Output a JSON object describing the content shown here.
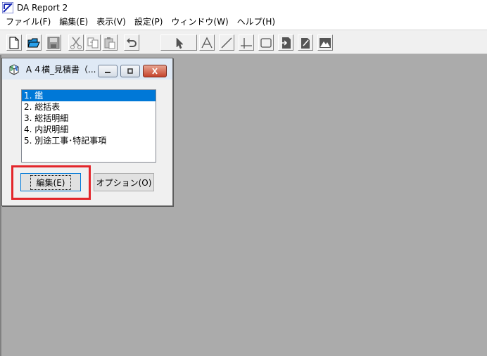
{
  "window": {
    "title": "DA Report 2"
  },
  "menu": [
    "ファイル(F)",
    "編集(E)",
    "表示(V)",
    "設定(P)",
    "ウィンドウ(W)",
    "ヘルプ(H)"
  ],
  "toolbar": {
    "buttons": [
      {
        "name": "new-file-icon"
      },
      {
        "name": "open-folder-icon"
      },
      {
        "name": "save-disk-icon"
      },
      {
        "name": "cut-scissors-icon"
      },
      {
        "name": "copy-icon"
      },
      {
        "name": "paste-icon"
      },
      {
        "name": "undo-icon"
      },
      {
        "name": "select-arrow-icon"
      },
      {
        "name": "text-tool-icon"
      },
      {
        "name": "line-tool-icon"
      },
      {
        "name": "perpendicular-line-icon"
      },
      {
        "name": "rectangle-tool-icon"
      },
      {
        "name": "insert-page-icon"
      },
      {
        "name": "edit-page-icon"
      },
      {
        "name": "image-tool-icon"
      }
    ]
  },
  "child_window": {
    "title": "Ａ４横_見積書（...",
    "list_items": [
      "1. 鑑",
      "2. 総括表",
      "3. 総括明細",
      "4. 内訳明細",
      "5. 別途工事･特記事項"
    ],
    "selected_index": 0,
    "edit_button": "編集(E)",
    "options_button": "オプション(O)"
  },
  "colors": {
    "highlight": "#e3262b",
    "selection": "#0078d7",
    "mdi_background": "#ababab"
  }
}
